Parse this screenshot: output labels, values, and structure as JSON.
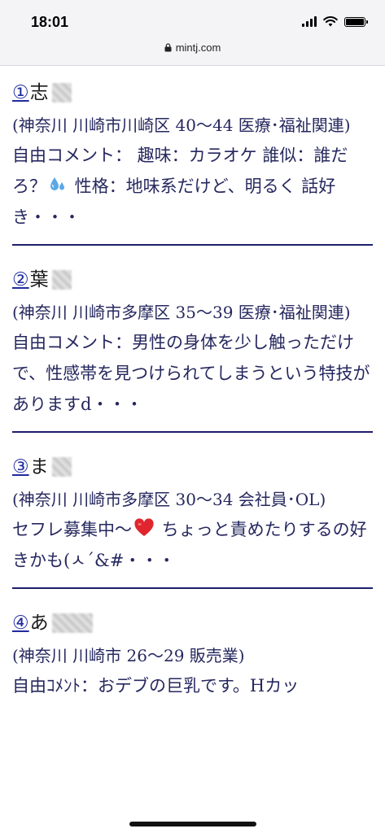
{
  "status_bar": {
    "time": "18:01",
    "url": "mintj.com",
    "icons": [
      "signal-icon",
      "wifi-icon",
      "battery-icon",
      "lock-icon"
    ]
  },
  "entries": [
    {
      "number": "①",
      "name": "志",
      "meta": "(神奈川 川崎市川崎区 40〜44 医療･福祉関連)",
      "comment_before_emoji": "自由コメント： 趣味：カラオケ 誰似：誰だろ？",
      "emoji": "sweat-droplets-icon",
      "comment_after_emoji": " 性格：地味系だけど、明るく 話好き・・・"
    },
    {
      "number": "②",
      "name": "葉",
      "meta": "(神奈川 川崎市多摩区 35〜39 医療･福祉関連)",
      "comment_before_emoji": "自由コメント：男性の身体を少し触っただけで、性感帯を見つけられてしまうという特技がありますd・・・",
      "emoji": "",
      "comment_after_emoji": ""
    },
    {
      "number": "③",
      "name": "ま",
      "meta": "(神奈川 川崎市多摩区 30〜34 会社員･OL)",
      "comment_before_emoji": "セフレ募集中〜",
      "emoji": "red-heart-icon",
      "comment_after_emoji": " ちょっと責めたりするの好きかも(ㅅ´&#・・・"
    },
    {
      "number": "④",
      "name": "あ",
      "meta": "(神奈川 川崎市 26〜29 販売業)",
      "comment_before_emoji": "自由ｺﾒﾝﾄ：おデブの巨乳です。Hカッ",
      "emoji": "",
      "comment_after_emoji": ""
    }
  ],
  "colors": {
    "link": "#1f2b9e",
    "text": "#26285f",
    "divider": "#1c1f6b"
  }
}
